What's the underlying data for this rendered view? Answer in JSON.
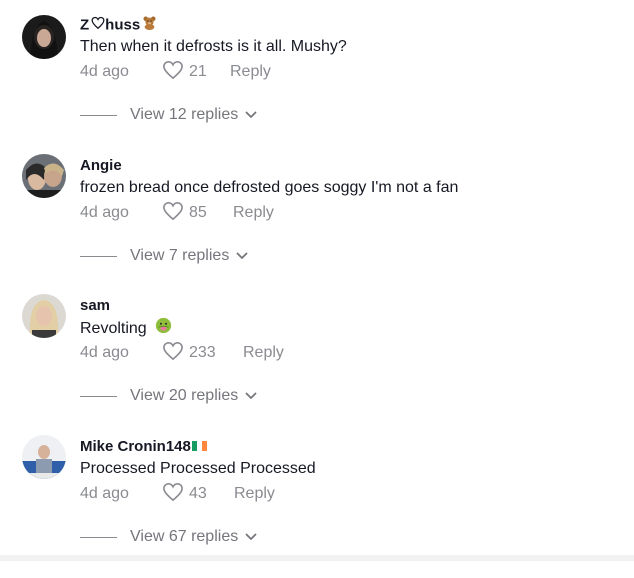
{
  "comments": [
    {
      "username": "Z",
      "username_rest": "huss",
      "text": "Then when it defrosts is it all. Mushy?",
      "time": "4d ago",
      "likes": "21",
      "reply_label": "Reply",
      "view_replies": "View 12 replies"
    },
    {
      "username": "Angie",
      "text": "frozen bread once defrosted goes soggy I'm not a fan",
      "time": "4d ago",
      "likes": "85",
      "reply_label": "Reply",
      "view_replies": "View 7 replies"
    },
    {
      "username": "sam",
      "text": "Revolting",
      "time": "4d ago",
      "likes": "233",
      "reply_label": "Reply",
      "view_replies": "View 20 replies"
    },
    {
      "username": "Mike Cronin148",
      "text": "Processed Processed Processed",
      "time": "4d ago",
      "likes": "43",
      "reply_label": "Reply",
      "view_replies": "View 67 replies"
    }
  ],
  "icons": {
    "like": "heart-outline-icon",
    "expand": "chevron-down-icon"
  },
  "colors": {
    "text": "#161823",
    "muted": "#8a8b91"
  }
}
